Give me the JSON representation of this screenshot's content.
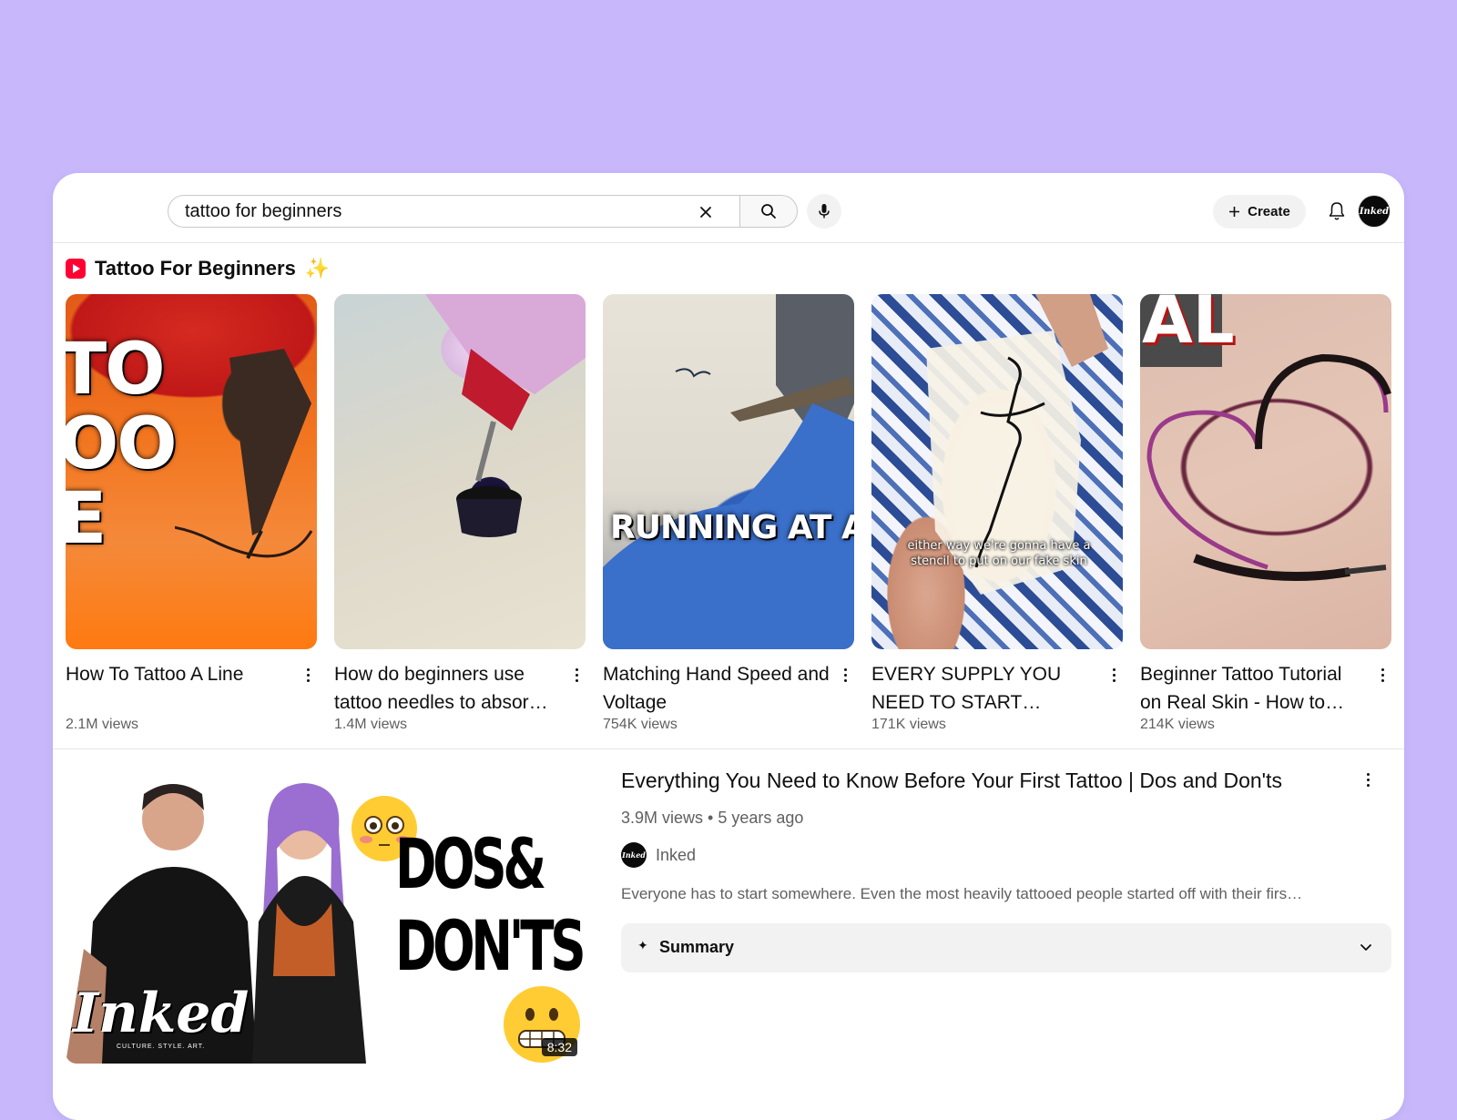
{
  "search": {
    "query": "tattoo for beginners",
    "clear_icon": "close-icon",
    "search_icon": "search-icon",
    "mic_icon": "microphone-icon"
  },
  "header": {
    "create_label": "Create",
    "create_icon": "plus-icon",
    "bell_icon": "bell-icon",
    "avatar_text": "Inked"
  },
  "shelf": {
    "title": "Tattoo For Beginners",
    "title_emoji": "✨",
    "icon": "shorts-icon",
    "items": [
      {
        "title": "How To Tattoo A Line",
        "views": "2.1M views",
        "thumb_text": "TO\nOO\nE"
      },
      {
        "title": "How do beginners use tattoo needles to absor…",
        "views": "1.4M views",
        "thumb_text": ""
      },
      {
        "title": "Matching Hand Speed and Voltage",
        "views": "754K views",
        "thumb_text": "RUNNING AT A"
      },
      {
        "title": "EVERY SUPPLY YOU NEED TO START…",
        "views": "171K views",
        "thumb_text": "either way we're gonna have a stencil to put on our fake skin"
      },
      {
        "title": "Beginner Tattoo Tutorial on Real Skin - How to…",
        "views": "214K views",
        "thumb_text": "AL"
      }
    ]
  },
  "video": {
    "title": "Everything You Need to Know Before Your First Tattoo | Dos and Don'ts",
    "views": "3.9M views",
    "age": "5 years ago",
    "channel": "Inked",
    "channel_avatar_text": "Inked",
    "description": "Everyone has to start somewhere. Even the most heavily tattooed people started off with their firs…",
    "duration": "8:32",
    "thumb_text_line1": "DOS&",
    "thumb_text_line2": "DON'TS",
    "thumb_brand": "Inked",
    "thumb_tagline": "CULTURE. STYLE. ART.",
    "emoji_top": "😳",
    "emoji_bottom": "😬",
    "summary_label": "Summary",
    "summary_icon": "sparkle-icon",
    "summary_chevron": "chevron-down-icon"
  },
  "colors": {
    "page_background": "#c8b8fb",
    "shorts_red": "#ff0033",
    "muted_text": "#606060"
  }
}
